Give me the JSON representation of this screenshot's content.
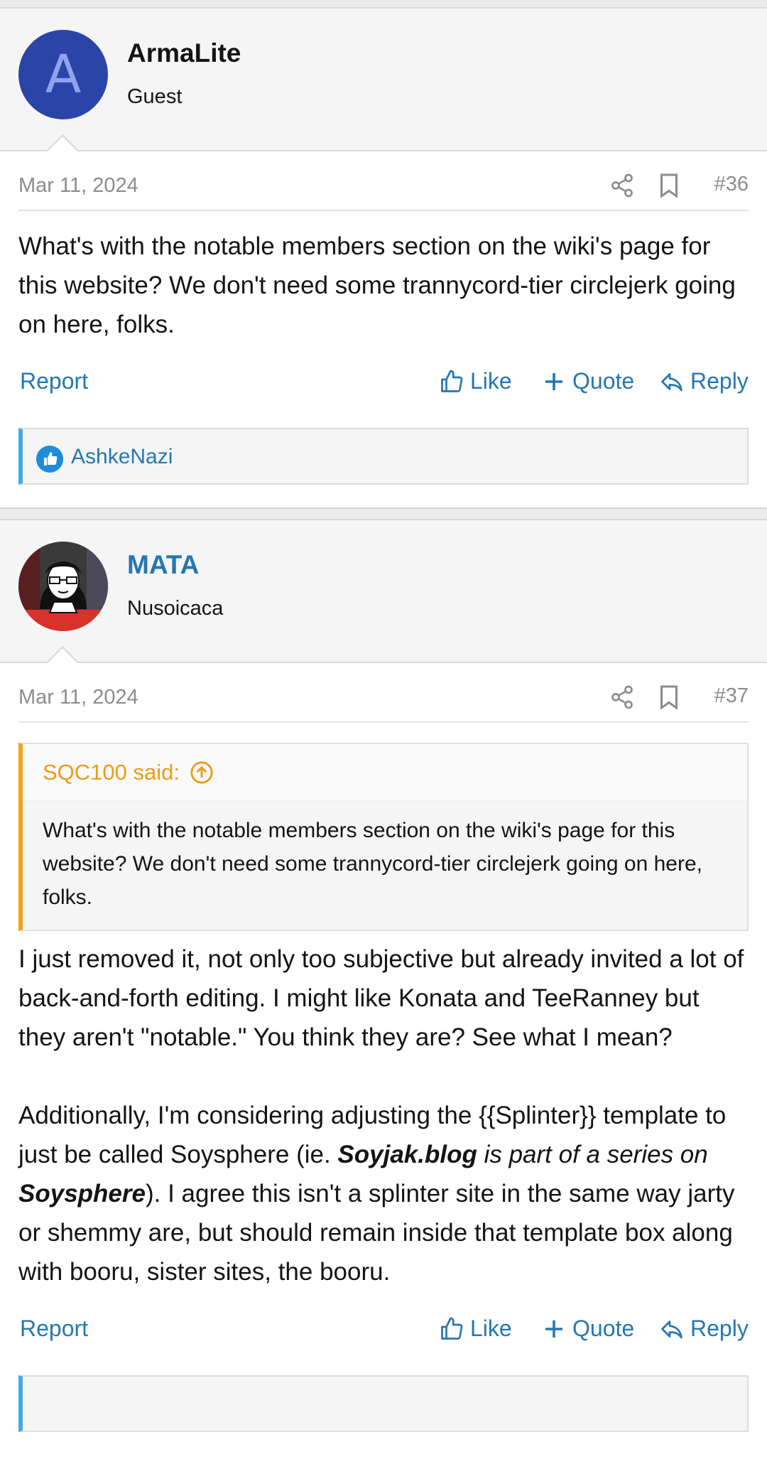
{
  "posts": [
    {
      "author": "ArmaLite",
      "user_title": "Guest",
      "avatar_letter": "A",
      "date": "Mar 11, 2024",
      "number": "#36",
      "body": "What's with the notable members section on the wiki's page for this website? We don't need some trannycord-tier circlejerk going on here, folks.",
      "reactions_user": "AshkeNazi"
    },
    {
      "author": "MATA",
      "user_title": "Nusoicaca",
      "date": "Mar 11, 2024",
      "number": "#37",
      "quote_author": "SQC100 said:",
      "quote_body": "What's with the notable members section on the wiki's page for this website? We don't need some trannycord-tier circlejerk going on here, folks.",
      "body_p1": "I just removed it, not only too subjective but already invited a lot of back-and-forth editing. I might like Konata and TeeRanney but they aren't \"notable.\" You think they are? See what I mean?",
      "body_p2_a": "Additionally, I'm considering adjusting the {{Splinter}} template to just be called Soysphere (ie. ",
      "body_p2_b": "Soyjak.blog",
      "body_p2_c": " is part of a series on ",
      "body_p2_d": "Soysphere",
      "body_p2_e": "). I agree this isn't a splinter site in the same way jarty or shemmy are, but should remain inside that template box along with booru, sister sites, the booru."
    }
  ],
  "actions": {
    "report": "Report",
    "like": "Like",
    "quote": "Quote",
    "reply": "Reply"
  },
  "colors": {
    "link": "#2577b1",
    "quote_accent": "#f3a21b",
    "reaction_accent": "#47a7eb",
    "avatar_bg": "#2b44a8"
  }
}
